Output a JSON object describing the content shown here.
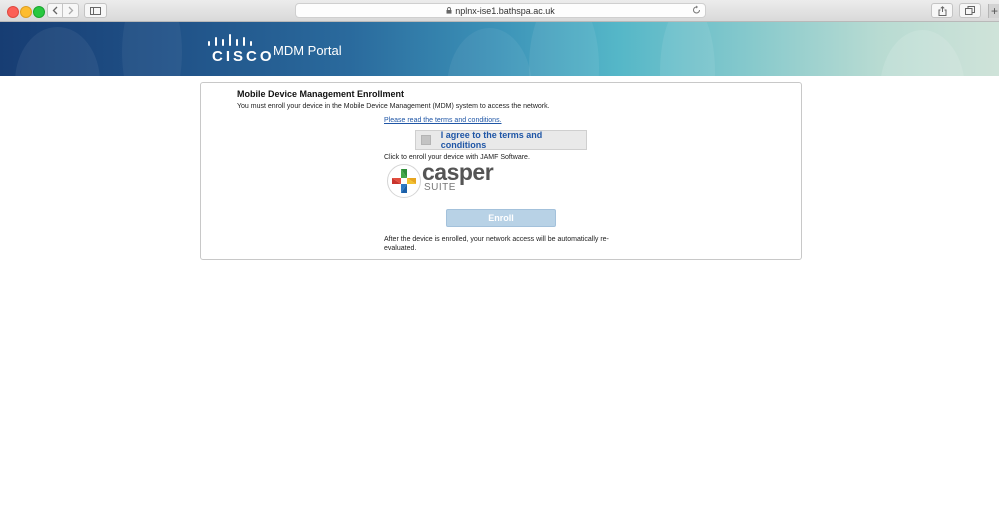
{
  "browser": {
    "url": "nplnx-ise1.bathspa.ac.uk",
    "icons": {
      "back": "chevron-left-icon",
      "forward": "chevron-right-icon",
      "sidebar": "sidebar-icon",
      "lock": "lock-icon",
      "reload": "reload-icon",
      "share": "share-icon",
      "tabs": "tabs-icon",
      "new_tab": "+"
    }
  },
  "header": {
    "brand": "CISCO",
    "title": "MDM Portal"
  },
  "content": {
    "heading": "Mobile Device Management Enrollment",
    "description": "You must enroll your device in the Mobile Device Management (MDM) system to access the network.",
    "terms_link": "Please read the terms and conditions.",
    "agree_label": "I agree to the terms and conditions",
    "agree_checked": false,
    "click_text": "Click to enroll your device with JAMF Software.",
    "logo_word": "casper",
    "logo_sub": "SUITE",
    "enroll_label": "Enroll",
    "after_text": "After the device is enrolled, your network access will be automatically re-evaluated."
  },
  "colors": {
    "link": "#1f56a6",
    "enroll_disabled": "#b8d2e6",
    "banner_start": "#173d73",
    "banner_end": "#cfe3d9"
  }
}
